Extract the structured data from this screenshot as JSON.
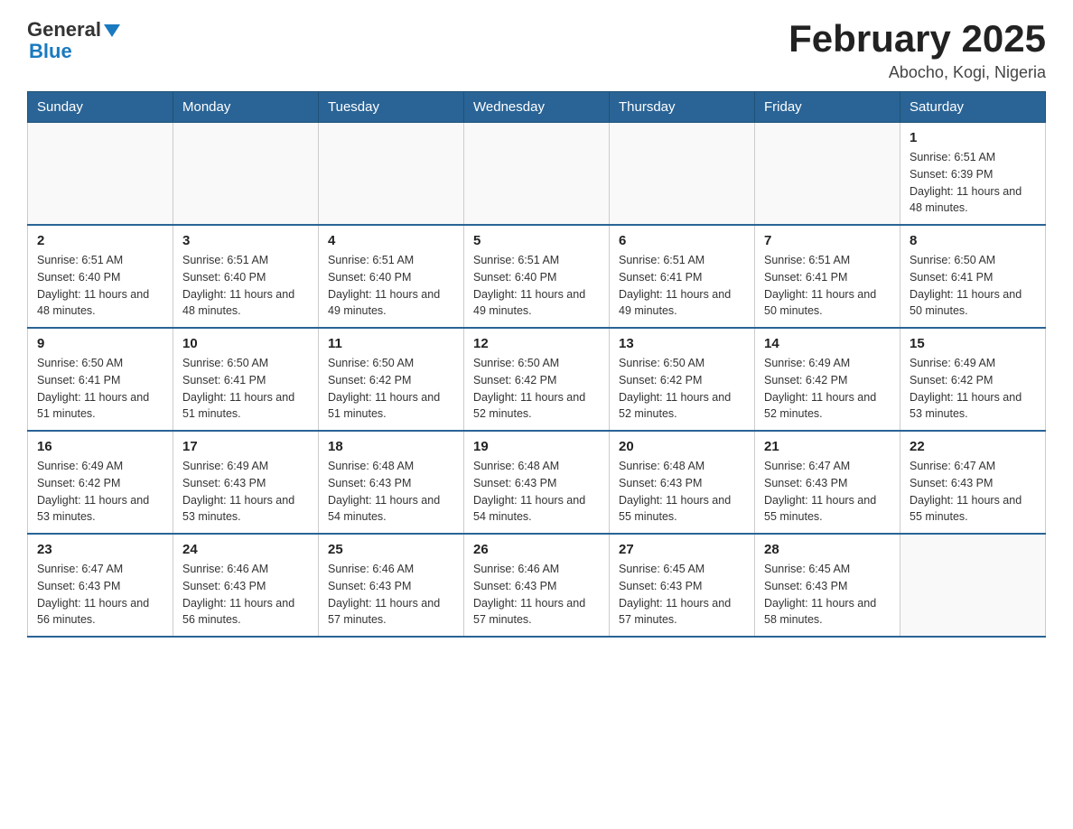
{
  "header": {
    "logo_general": "General",
    "logo_blue": "Blue",
    "title": "February 2025",
    "subtitle": "Abocho, Kogi, Nigeria"
  },
  "days_of_week": [
    "Sunday",
    "Monday",
    "Tuesday",
    "Wednesday",
    "Thursday",
    "Friday",
    "Saturday"
  ],
  "weeks": [
    {
      "days": [
        {
          "num": "",
          "info": ""
        },
        {
          "num": "",
          "info": ""
        },
        {
          "num": "",
          "info": ""
        },
        {
          "num": "",
          "info": ""
        },
        {
          "num": "",
          "info": ""
        },
        {
          "num": "",
          "info": ""
        },
        {
          "num": "1",
          "info": "Sunrise: 6:51 AM\nSunset: 6:39 PM\nDaylight: 11 hours\nand 48 minutes."
        }
      ]
    },
    {
      "days": [
        {
          "num": "2",
          "info": "Sunrise: 6:51 AM\nSunset: 6:40 PM\nDaylight: 11 hours\nand 48 minutes."
        },
        {
          "num": "3",
          "info": "Sunrise: 6:51 AM\nSunset: 6:40 PM\nDaylight: 11 hours\nand 48 minutes."
        },
        {
          "num": "4",
          "info": "Sunrise: 6:51 AM\nSunset: 6:40 PM\nDaylight: 11 hours\nand 49 minutes."
        },
        {
          "num": "5",
          "info": "Sunrise: 6:51 AM\nSunset: 6:40 PM\nDaylight: 11 hours\nand 49 minutes."
        },
        {
          "num": "6",
          "info": "Sunrise: 6:51 AM\nSunset: 6:41 PM\nDaylight: 11 hours\nand 49 minutes."
        },
        {
          "num": "7",
          "info": "Sunrise: 6:51 AM\nSunset: 6:41 PM\nDaylight: 11 hours\nand 50 minutes."
        },
        {
          "num": "8",
          "info": "Sunrise: 6:50 AM\nSunset: 6:41 PM\nDaylight: 11 hours\nand 50 minutes."
        }
      ]
    },
    {
      "days": [
        {
          "num": "9",
          "info": "Sunrise: 6:50 AM\nSunset: 6:41 PM\nDaylight: 11 hours\nand 51 minutes."
        },
        {
          "num": "10",
          "info": "Sunrise: 6:50 AM\nSunset: 6:41 PM\nDaylight: 11 hours\nand 51 minutes."
        },
        {
          "num": "11",
          "info": "Sunrise: 6:50 AM\nSunset: 6:42 PM\nDaylight: 11 hours\nand 51 minutes."
        },
        {
          "num": "12",
          "info": "Sunrise: 6:50 AM\nSunset: 6:42 PM\nDaylight: 11 hours\nand 52 minutes."
        },
        {
          "num": "13",
          "info": "Sunrise: 6:50 AM\nSunset: 6:42 PM\nDaylight: 11 hours\nand 52 minutes."
        },
        {
          "num": "14",
          "info": "Sunrise: 6:49 AM\nSunset: 6:42 PM\nDaylight: 11 hours\nand 52 minutes."
        },
        {
          "num": "15",
          "info": "Sunrise: 6:49 AM\nSunset: 6:42 PM\nDaylight: 11 hours\nand 53 minutes."
        }
      ]
    },
    {
      "days": [
        {
          "num": "16",
          "info": "Sunrise: 6:49 AM\nSunset: 6:42 PM\nDaylight: 11 hours\nand 53 minutes."
        },
        {
          "num": "17",
          "info": "Sunrise: 6:49 AM\nSunset: 6:43 PM\nDaylight: 11 hours\nand 53 minutes."
        },
        {
          "num": "18",
          "info": "Sunrise: 6:48 AM\nSunset: 6:43 PM\nDaylight: 11 hours\nand 54 minutes."
        },
        {
          "num": "19",
          "info": "Sunrise: 6:48 AM\nSunset: 6:43 PM\nDaylight: 11 hours\nand 54 minutes."
        },
        {
          "num": "20",
          "info": "Sunrise: 6:48 AM\nSunset: 6:43 PM\nDaylight: 11 hours\nand 55 minutes."
        },
        {
          "num": "21",
          "info": "Sunrise: 6:47 AM\nSunset: 6:43 PM\nDaylight: 11 hours\nand 55 minutes."
        },
        {
          "num": "22",
          "info": "Sunrise: 6:47 AM\nSunset: 6:43 PM\nDaylight: 11 hours\nand 55 minutes."
        }
      ]
    },
    {
      "days": [
        {
          "num": "23",
          "info": "Sunrise: 6:47 AM\nSunset: 6:43 PM\nDaylight: 11 hours\nand 56 minutes."
        },
        {
          "num": "24",
          "info": "Sunrise: 6:46 AM\nSunset: 6:43 PM\nDaylight: 11 hours\nand 56 minutes."
        },
        {
          "num": "25",
          "info": "Sunrise: 6:46 AM\nSunset: 6:43 PM\nDaylight: 11 hours\nand 57 minutes."
        },
        {
          "num": "26",
          "info": "Sunrise: 6:46 AM\nSunset: 6:43 PM\nDaylight: 11 hours\nand 57 minutes."
        },
        {
          "num": "27",
          "info": "Sunrise: 6:45 AM\nSunset: 6:43 PM\nDaylight: 11 hours\nand 57 minutes."
        },
        {
          "num": "28",
          "info": "Sunrise: 6:45 AM\nSunset: 6:43 PM\nDaylight: 11 hours\nand 58 minutes."
        },
        {
          "num": "",
          "info": ""
        }
      ]
    }
  ]
}
